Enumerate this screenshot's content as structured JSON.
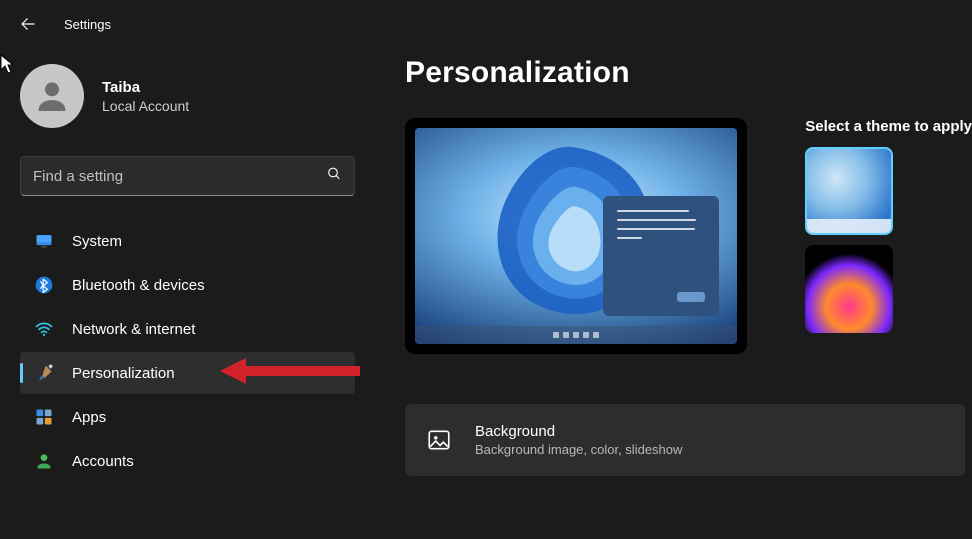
{
  "titlebar": {
    "title": "Settings"
  },
  "user": {
    "name": "Taiba",
    "account": "Local Account"
  },
  "search": {
    "placeholder": "Find a setting"
  },
  "nav": {
    "items": [
      {
        "id": "system",
        "label": "System"
      },
      {
        "id": "bluetooth",
        "label": "Bluetooth & devices"
      },
      {
        "id": "network",
        "label": "Network & internet"
      },
      {
        "id": "personalization",
        "label": "Personalization",
        "selected": true
      },
      {
        "id": "apps",
        "label": "Apps"
      },
      {
        "id": "accounts",
        "label": "Accounts"
      }
    ]
  },
  "main": {
    "heading": "Personalization",
    "themes_heading": "Select a theme to apply",
    "background_card": {
      "title": "Background",
      "subtitle": "Background image, color, slideshow"
    }
  }
}
